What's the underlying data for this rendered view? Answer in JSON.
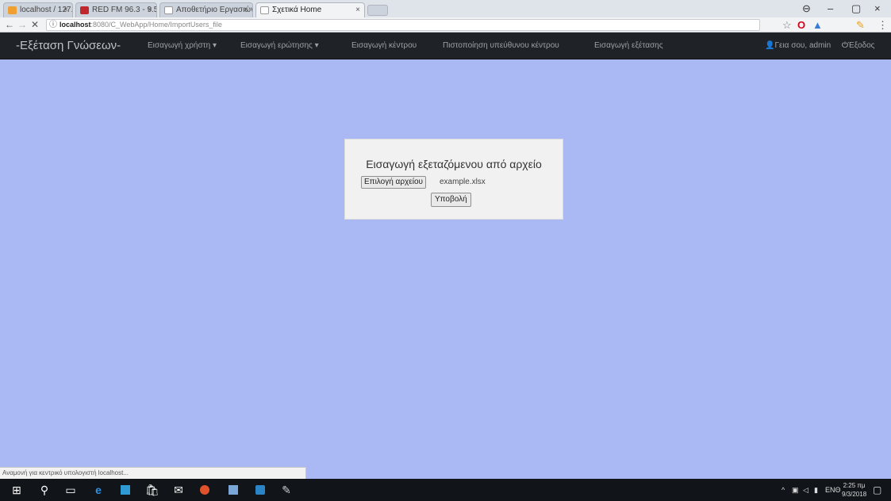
{
  "browser": {
    "tabs": [
      {
        "title": "localhost / 127.0.0.1 / ..."
      },
      {
        "title": "RED FM 96.3 - 9.5 FM"
      },
      {
        "title": "Αποθετήριο Εργασιών"
      },
      {
        "title": "Σχετικά Home",
        "active": true
      }
    ],
    "url_host": "localhost",
    "url_rest": ":8080/C_WebApp/Home/ImportUsers_file",
    "colors": {
      "tab_bar": "#dfe3ea",
      "toolbar": "#f2f3f5"
    }
  },
  "navbar": {
    "brand": "-Εξέταση Γνώσεων-",
    "items": [
      {
        "label": "Εισαγωγή χρήστη ▾"
      },
      {
        "label": "Εισαγωγή ερώτησης ▾"
      },
      {
        "label": "Εισαγωγή κέντρου"
      },
      {
        "label": "Πιστοποίηση υπεύθυνου κέντρου"
      },
      {
        "label": "Εισαγωγή εξέτασης"
      }
    ],
    "user_label": "Γεια σου, admin",
    "logout_label": "Έξοδος",
    "colors": {
      "background": "#1f2226",
      "text": "#9da2a8"
    }
  },
  "page": {
    "background": "#aab8f3",
    "panel_title": "Εισαγωγή εξεταζόμενου από αρχείο",
    "choose_file_label": "Επιλογή αρχείου",
    "file_name": "example.xlsx",
    "submit_label": "Υποβολή"
  },
  "status_bar": "Αναμονή για κεντρικό υπολογιστή localhost...",
  "taskbar": {
    "time": "2:25 πμ",
    "date": "9/3/2018",
    "lang": "ΕΝΘ"
  }
}
